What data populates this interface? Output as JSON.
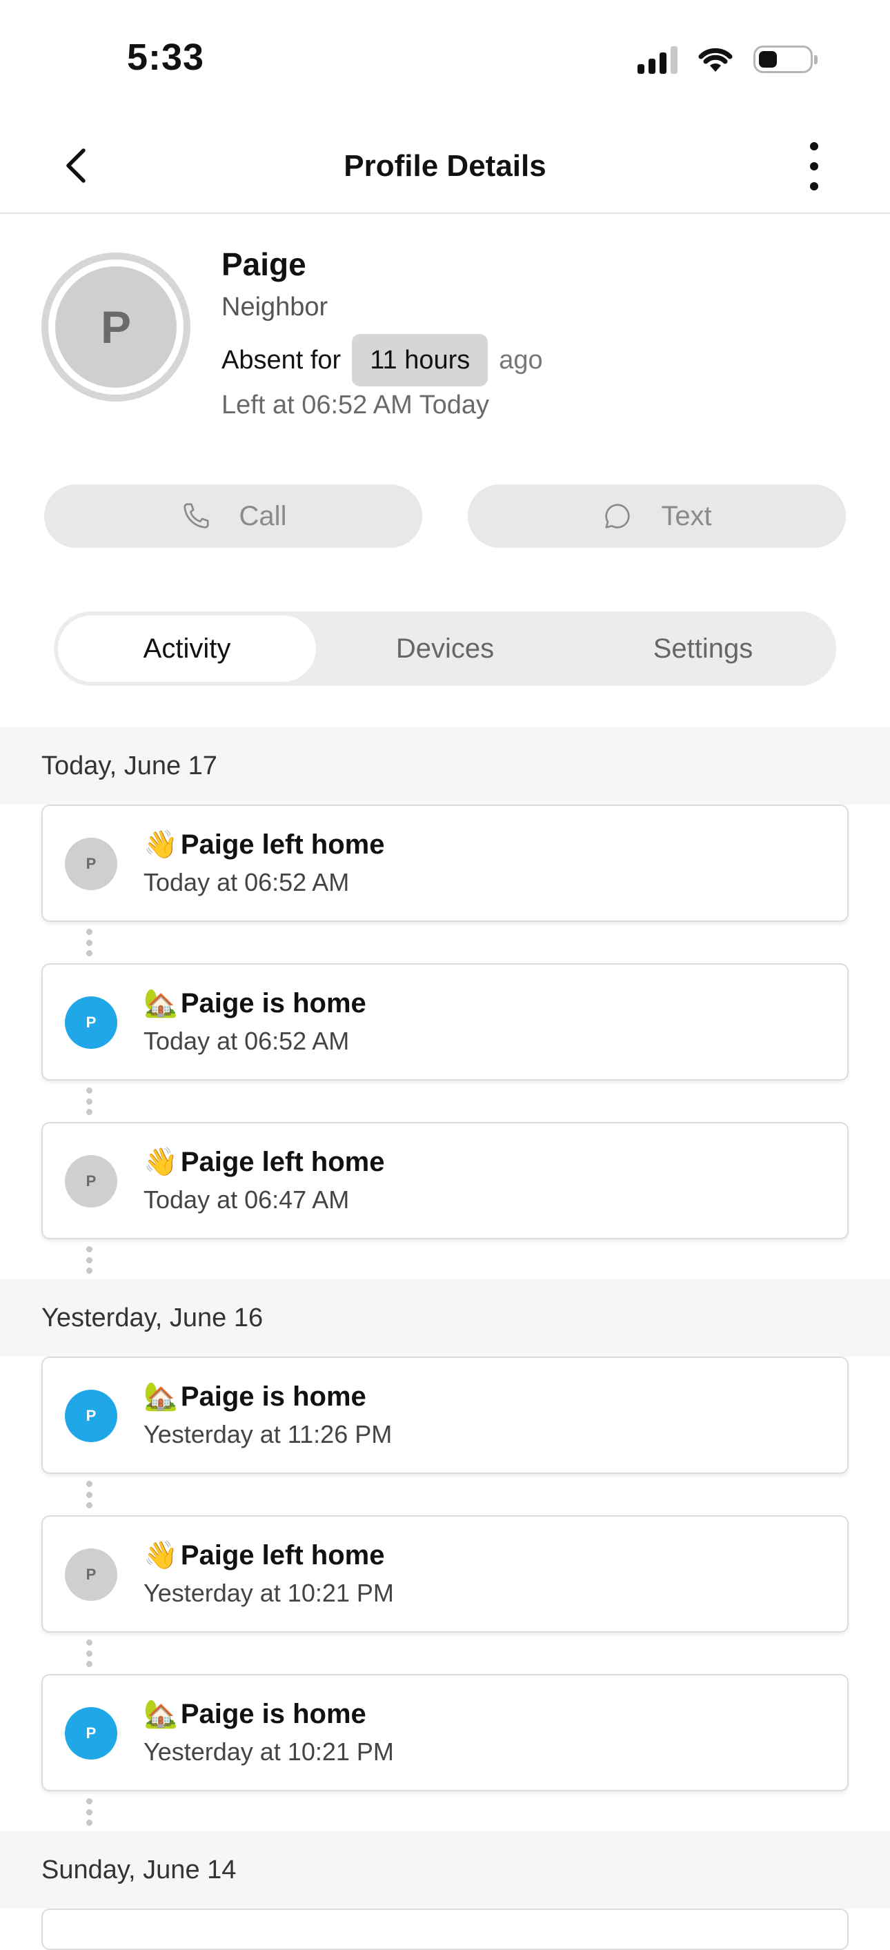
{
  "status_bar": {
    "time": "5:33"
  },
  "header": {
    "title": "Profile Details"
  },
  "profile": {
    "initial": "P",
    "name": "Paige",
    "role": "Neighbor",
    "absent_label": "Absent for",
    "absent_duration": "11 hours",
    "absent_suffix": "ago",
    "left_at": "Left at 06:52 AM Today"
  },
  "actions": {
    "call_label": "Call",
    "text_label": "Text"
  },
  "tabs": [
    {
      "label": "Activity",
      "active": true
    },
    {
      "label": "Devices",
      "active": false
    },
    {
      "label": "Settings",
      "active": false
    }
  ],
  "activity": {
    "groups": [
      {
        "date": "Today, June 17",
        "events": [
          {
            "emoji": "👋",
            "title": "Paige left home",
            "time": "Today at 06:52 AM",
            "status": "away",
            "initial": "P"
          },
          {
            "emoji": "🏡",
            "title": "Paige is home",
            "time": "Today at 06:52 AM",
            "status": "home",
            "initial": "P"
          },
          {
            "emoji": "👋",
            "title": "Paige left home",
            "time": "Today at 06:47 AM",
            "status": "away",
            "initial": "P"
          }
        ]
      },
      {
        "date": "Yesterday, June 16",
        "events": [
          {
            "emoji": "🏡",
            "title": "Paige is home",
            "time": "Yesterday at 11:26 PM",
            "status": "home",
            "initial": "P"
          },
          {
            "emoji": "👋",
            "title": "Paige left home",
            "time": "Yesterday at 10:21 PM",
            "status": "away",
            "initial": "P"
          },
          {
            "emoji": "🏡",
            "title": "Paige is home",
            "time": "Yesterday at 10:21 PM",
            "status": "home",
            "initial": "P"
          }
        ]
      },
      {
        "date": "Sunday, June 14",
        "events": []
      }
    ]
  },
  "colors": {
    "home_avatar": "#1fa7e8",
    "away_avatar": "#cfcfd1",
    "date_header_bg": "#f5f6f8",
    "button_bg": "#e8e8e9"
  }
}
